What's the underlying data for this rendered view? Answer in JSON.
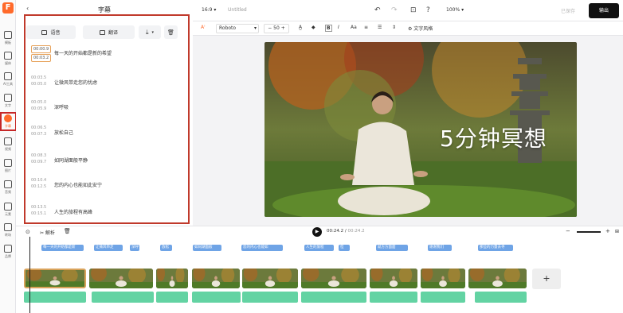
{
  "rail": {
    "logo": "F",
    "items": [
      {
        "label": "模板",
        "icon": "template-icon"
      },
      {
        "label": "媒体",
        "icon": "folder-icon"
      },
      {
        "label": "AI工具",
        "icon": "ai-icon"
      },
      {
        "label": "文字",
        "icon": "text-icon"
      },
      {
        "label": "字幕",
        "icon": "subtitle-icon",
        "active": true
      },
      {
        "label": "视频",
        "icon": "video-icon"
      },
      {
        "label": "图片",
        "icon": "image-icon"
      },
      {
        "label": "音频",
        "icon": "music-icon"
      },
      {
        "label": "元素",
        "icon": "shapes-icon"
      },
      {
        "label": "转场",
        "icon": "transition-icon"
      },
      {
        "label": "品牌",
        "icon": "brand-icon"
      }
    ]
  },
  "panel": {
    "title": "字幕",
    "btn_speech": "语音",
    "btn_translate": "翻译",
    "subtitles": [
      {
        "start": "00:00.9",
        "end": "00:03.2",
        "text": "每一天的开始都是新的希望",
        "selected": true
      },
      {
        "start": "00:03.5",
        "end": "00:05.0",
        "text": "让微风带走您的忧虑"
      },
      {
        "start": "00:05.0",
        "end": "00:05.9",
        "text": "深呼吸"
      },
      {
        "start": "00:06.5",
        "end": "00:07.3",
        "text": "放松自己"
      },
      {
        "start": "00:08.3",
        "end": "00:09.7",
        "text": "如同湖面般平静"
      },
      {
        "start": "00:10.4",
        "end": "00:12.5",
        "text": "您的内心也能如此安宁"
      },
      {
        "start": "00:13.5",
        "end": "00:15.1",
        "text": "人生的旅程有高峰"
      }
    ]
  },
  "topbar": {
    "ratio": "16:9",
    "doc_title": "Untitled",
    "zoom": "100%",
    "saved": "已保存",
    "export": "输出"
  },
  "format": {
    "font": "Roboto",
    "size": "50",
    "style_btn": "文字风格"
  },
  "canvas": {
    "overlay_text": "5分钟冥想"
  },
  "timeline": {
    "split": "解析",
    "time_current": "00:24.2",
    "time_total": "00:24.2",
    "chips": [
      "每一天的开始都是新",
      "让微风带走",
      "深呼",
      "放松",
      "如同湖面般",
      "您的内心也能如",
      "人生的旅程",
      "但",
      "就方方面面",
      "谢谢我们",
      "那些的力量去寻"
    ]
  },
  "colors": {
    "accent": "#ff6a2b",
    "highlight_box": "#c0392b",
    "subtitle_chip": "#6fa4e6",
    "audio_track": "#63d3a3"
  }
}
